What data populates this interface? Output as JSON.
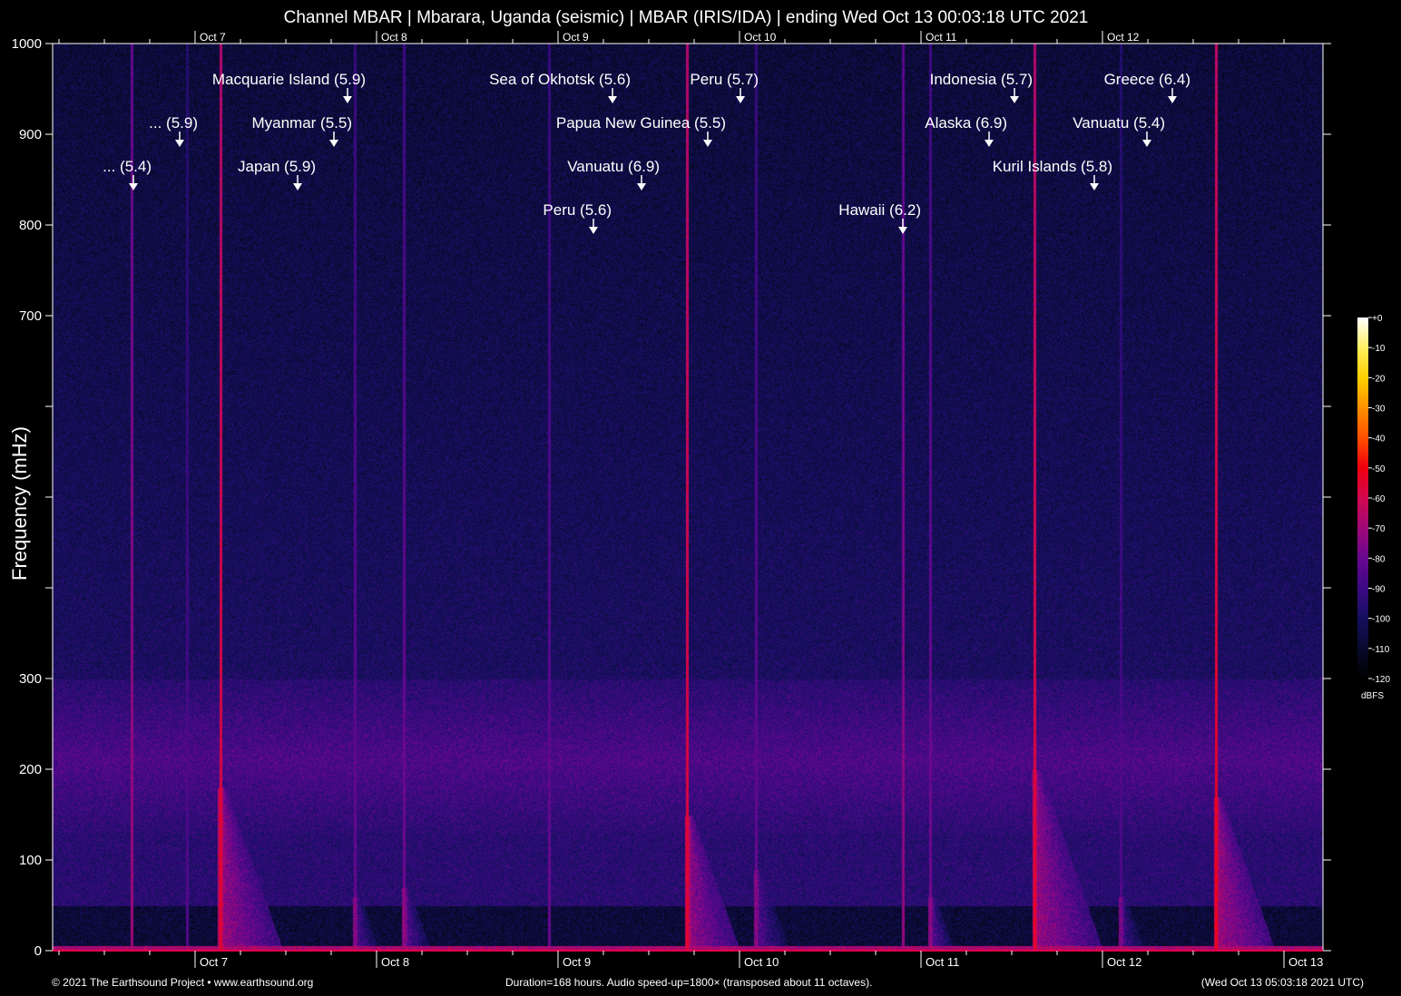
{
  "title": "Channel MBAR | Mbarara, Uganda (seismic) | MBAR (IRIS/IDA) | ending Wed Oct 13 00:03:18 UTC 2021",
  "footer": {
    "left": "© 2021 The Earthsound Project • www.earthsound.org",
    "center": "Duration=168 hours. Audio speed-up=1800× (transposed about 11 octaves).",
    "right": "(Wed Oct 13 05:03:18 2021 UTC)"
  },
  "chart_data": {
    "type": "heatmap",
    "title": "Channel MBAR | Mbarara, Uganda (seismic) | MBAR (IRIS/IDA) | ending Wed Oct 13 00:03:18 UTC 2021",
    "ylabel": "Frequency (mHz)",
    "xlabel": "",
    "ylim": [
      0,
      1000
    ],
    "xlim_days": [
      6.215,
      13.215
    ],
    "y_ticks": [
      0,
      100,
      200,
      300,
      400,
      500,
      600,
      700,
      800,
      900,
      1000
    ],
    "y_tick_labels": [
      "0",
      "100",
      "200",
      "300",
      "",
      "",
      "",
      "700",
      "800",
      "900",
      "1000"
    ],
    "x_ticks": [
      {
        "day": 7,
        "label": "Oct 7"
      },
      {
        "day": 8,
        "label": "Oct 8"
      },
      {
        "day": 9,
        "label": "Oct 9"
      },
      {
        "day": 10,
        "label": "Oct 10"
      },
      {
        "day": 11,
        "label": "Oct 11"
      },
      {
        "day": 12,
        "label": "Oct 12"
      },
      {
        "day": 13,
        "label": "Oct 13"
      }
    ],
    "x_top_ticks": [
      "Oct 7",
      "Oct 8",
      "Oct 9",
      "Oct 10",
      "Oct 11",
      "Oct 12"
    ],
    "colorbar": {
      "unit": "dBFS",
      "range": [
        -120,
        0
      ],
      "labels": [
        "+0",
        "-10",
        "-20",
        "-30",
        "-40",
        "-50",
        "-60",
        "-70",
        "-80",
        "-90",
        "-100",
        "-110",
        "-120"
      ]
    },
    "events": [
      {
        "label": "... (5.4)",
        "day": 6.66,
        "freq": 838,
        "row": 3
      },
      {
        "label": "... (5.9)",
        "day": 6.915,
        "freq": 886,
        "row": 2
      },
      {
        "label": "Japan (5.9)",
        "day": 7.565,
        "freq": 838,
        "row": 3
      },
      {
        "label": "Myanmar (5.5)",
        "day": 7.765,
        "freq": 886,
        "row": 2
      },
      {
        "label": "Macquarie Island (5.9)",
        "day": 7.84,
        "freq": 934,
        "row": 1
      },
      {
        "label": "Peru (5.6)",
        "day": 9.195,
        "freq": 790,
        "row": 4
      },
      {
        "label": "Sea of Okhotsk (5.6)",
        "day": 9.3,
        "freq": 934,
        "row": 1
      },
      {
        "label": "Vanuatu (6.9)",
        "day": 9.46,
        "freq": 838,
        "row": 3
      },
      {
        "label": "Papua New Guinea (5.5)",
        "day": 9.825,
        "freq": 886,
        "row": 2
      },
      {
        "label": "Peru (5.7)",
        "day": 10.005,
        "freq": 934,
        "row": 1
      },
      {
        "label": "Hawaii (6.2)",
        "day": 10.9,
        "freq": 790,
        "row": 4
      },
      {
        "label": "Alaska (6.9)",
        "day": 11.375,
        "freq": 886,
        "row": 2
      },
      {
        "label": "Indonesia (5.7)",
        "day": 11.515,
        "freq": 934,
        "row": 1
      },
      {
        "label": "Kuril Islands (5.8)",
        "day": 11.955,
        "freq": 838,
        "row": 3
      },
      {
        "label": "Vanuatu (5.4)",
        "day": 12.245,
        "freq": 886,
        "row": 2
      },
      {
        "label": "Greece (6.4)",
        "day": 12.385,
        "freq": 934,
        "row": 1
      }
    ],
    "signal_streaks": [
      {
        "day": 6.65,
        "peak_db": -70,
        "burst": 0
      },
      {
        "day": 6.955,
        "peak_db": -85,
        "burst": 0
      },
      {
        "day": 7.14,
        "peak_db": -55,
        "burst": 180
      },
      {
        "day": 7.88,
        "peak_db": -80,
        "burst": 60
      },
      {
        "day": 8.15,
        "peak_db": -78,
        "burst": 70
      },
      {
        "day": 8.95,
        "peak_db": -80,
        "burst": 0
      },
      {
        "day": 9.71,
        "peak_db": -55,
        "burst": 150
      },
      {
        "day": 10.09,
        "peak_db": -80,
        "burst": 90
      },
      {
        "day": 10.9,
        "peak_db": -72,
        "burst": 0
      },
      {
        "day": 11.05,
        "peak_db": -78,
        "burst": 60
      },
      {
        "day": 11.625,
        "peak_db": -55,
        "burst": 200
      },
      {
        "day": 12.1,
        "peak_db": -85,
        "burst": 60
      },
      {
        "day": 12.625,
        "peak_db": -52,
        "burst": 170
      }
    ]
  }
}
